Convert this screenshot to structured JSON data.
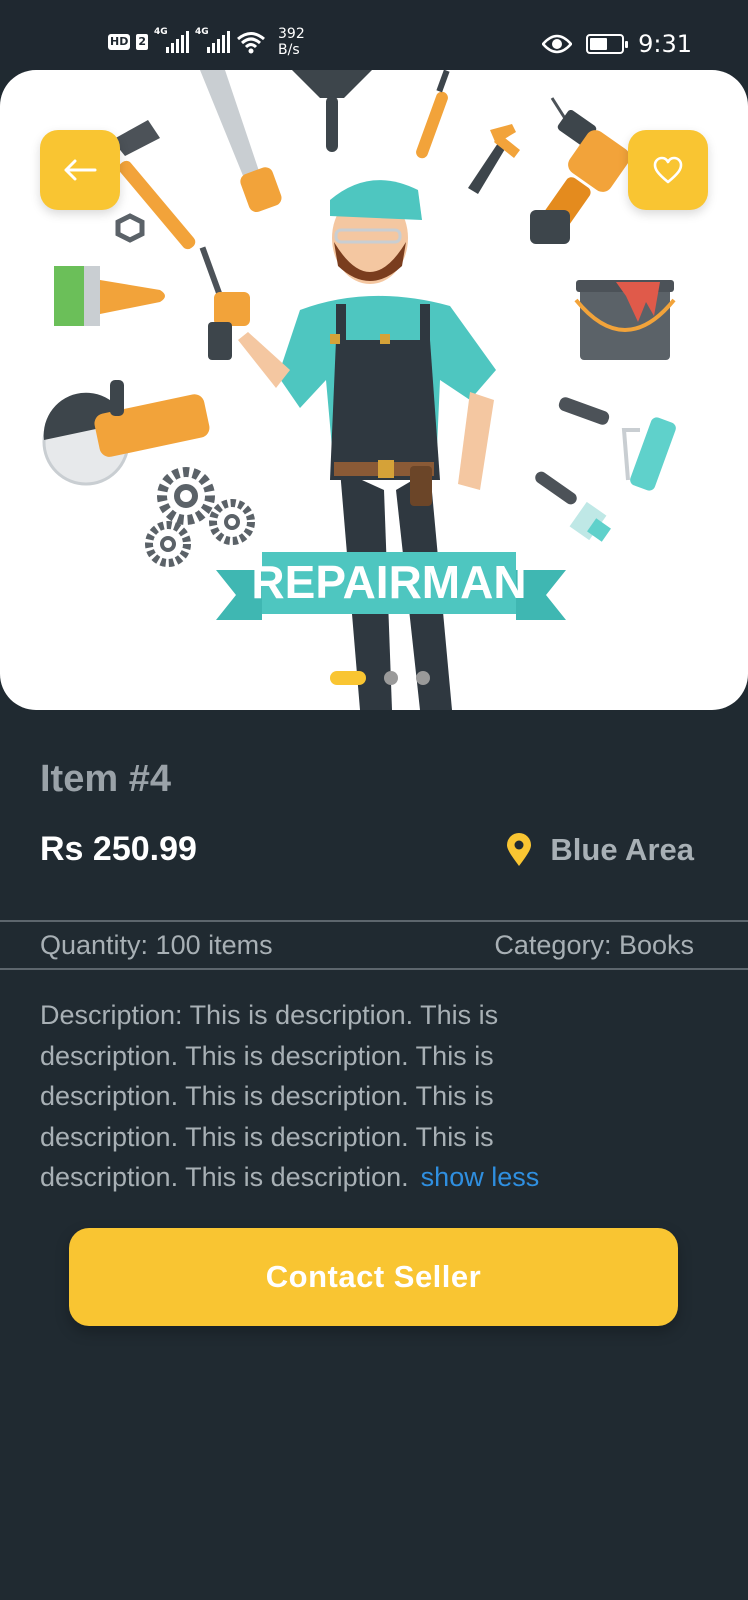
{
  "status_bar": {
    "hd": "HD",
    "sim": "2",
    "net1": "4G",
    "net2": "4G",
    "speed_value": "392",
    "speed_unit": "B/s",
    "time": "9:31",
    "battery_level": 0.55,
    "icons": [
      "wifi-icon",
      "eye-icon",
      "battery-icon",
      "signal-icon"
    ]
  },
  "hero": {
    "banner_text": "REPAIRMAN",
    "carousel": {
      "count": 3,
      "active_index": 0
    },
    "back_icon": "arrow-left-icon",
    "favorite_icon": "heart-outline-icon"
  },
  "item": {
    "title": "Item #4",
    "price": "Rs 250.99",
    "location": "Blue Area",
    "location_icon": "map-pin-icon",
    "quantity": "Quantity: 100 items",
    "category": "Category: Books",
    "description_lines": [
      "Description: This is description. This is",
      "description. This is description. This is",
      "description. This is description. This is",
      "description. This is description. This is",
      "description. This is description."
    ],
    "show_less": "show less"
  },
  "actions": {
    "contact_label": "Contact Seller"
  },
  "colors": {
    "background": "#202a31",
    "accent": "#f9c532",
    "link": "#2f8fe0",
    "muted_text": "#a8b0b5"
  }
}
